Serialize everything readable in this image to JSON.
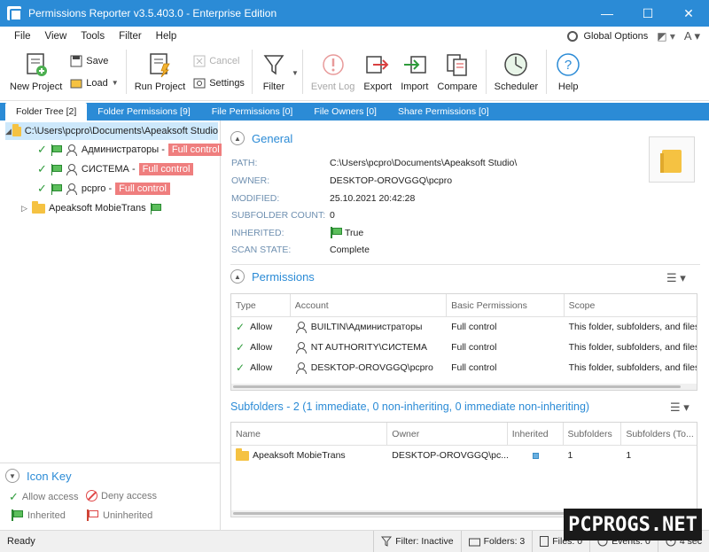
{
  "window": {
    "title": "Permissions Reporter v3.5.403.0 - Enterprise Edition",
    "min": "—",
    "max": "☐",
    "close": "✕"
  },
  "menu": {
    "items": [
      "File",
      "View",
      "Tools",
      "Filter",
      "Help"
    ],
    "global_options": "Global Options"
  },
  "toolbar": {
    "new_project": "New Project",
    "save": "Save",
    "load": "Load",
    "run_project": "Run Project",
    "cancel": "Cancel",
    "settings": "Settings",
    "filter": "Filter",
    "event_log": "Event Log",
    "export": "Export",
    "import": "Import",
    "compare": "Compare",
    "scheduler": "Scheduler",
    "help": "Help"
  },
  "tabs": [
    "Folder Tree [2]",
    "Folder Permissions [9]",
    "File Permissions [0]",
    "File Owners [0]",
    "Share Permissions [0]"
  ],
  "tree": {
    "root": "C:\\Users\\pcpro\\Documents\\Apeaksoft Studio",
    "children": [
      {
        "name": "Администраторы -",
        "badge": "Full control"
      },
      {
        "name": "СИСТЕМА -",
        "badge": "Full control"
      },
      {
        "name": "pcpro -",
        "badge": "Full control"
      }
    ],
    "subfolder": "Apeaksoft MobieTrans"
  },
  "icon_key": {
    "title": "Icon Key",
    "allow": "Allow access",
    "deny": "Deny access",
    "inherited": "Inherited",
    "uninherited": "Uninherited"
  },
  "general": {
    "title": "General",
    "path_label": "PATH:",
    "path": "C:\\Users\\pcpro\\Documents\\Apeaksoft Studio\\",
    "owner_label": "OWNER:",
    "owner": "DESKTOP-OROVGGQ\\pcpro",
    "modified_label": "MODIFIED:",
    "modified": "25.10.2021 20:42:28",
    "subfolder_count_label": "SUBFOLDER COUNT:",
    "subfolder_count": "0",
    "inherited_label": "INHERITED:",
    "inherited": "True",
    "scan_state_label": "SCAN STATE:",
    "scan_state": "Complete"
  },
  "permissions": {
    "title": "Permissions",
    "columns": [
      "Type",
      "Account",
      "Basic Permissions",
      "Scope"
    ],
    "rows": [
      {
        "type": "Allow",
        "account": "BUILTIN\\Администраторы",
        "perm": "Full control",
        "scope": "This folder, subfolders, and files"
      },
      {
        "type": "Allow",
        "account": "NT AUTHORITY\\СИСТЕМА",
        "perm": "Full control",
        "scope": "This folder, subfolders, and files"
      },
      {
        "type": "Allow",
        "account": "DESKTOP-OROVGGQ\\pcpro",
        "perm": "Full control",
        "scope": "This folder, subfolders, and files"
      }
    ]
  },
  "subfolders": {
    "title": "Subfolders - 2 (1 immediate, 0 non-inheriting, 0 immediate non-inheriting)",
    "columns": [
      "Name",
      "Owner",
      "Inherited",
      "Subfolders",
      "Subfolders (To..."
    ],
    "rows": [
      {
        "name": "Apeaksoft MobieTrans",
        "owner": "DESKTOP-OROVGGQ\\pc...",
        "subfolders": "1",
        "subfolders_total": "1"
      }
    ]
  },
  "status": {
    "ready": "Ready",
    "filter": "Filter: Inactive",
    "folders": "Folders: 3",
    "files": "Files: 0",
    "events": "Events: 0",
    "time": "4 sec"
  },
  "watermark": "PCPROGS.NET"
}
